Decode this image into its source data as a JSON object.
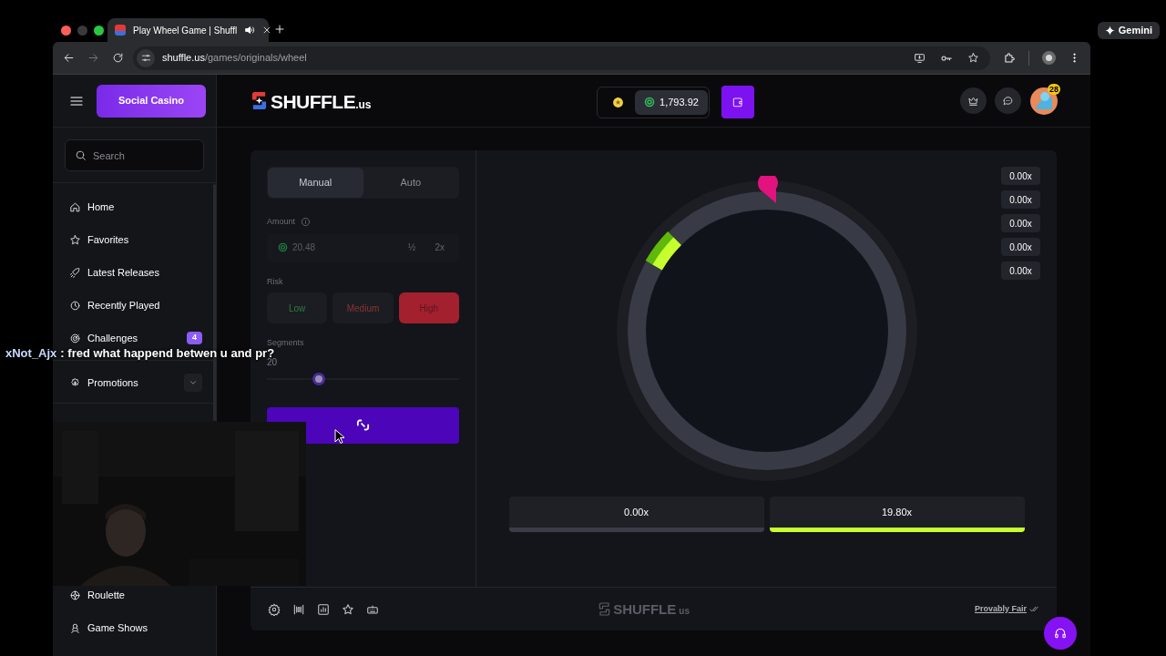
{
  "browser": {
    "tab": {
      "title": "Play Wheel Game | Shuffl"
    },
    "url": {
      "host": "shuffle.us",
      "path": "/games/originals/wheel"
    },
    "gemini": "Gemini"
  },
  "sidebar": {
    "promo_button": "Social Casino",
    "search": {
      "placeholder": "Search"
    },
    "items": [
      {
        "label": "Home",
        "kind": "link"
      },
      {
        "label": "Favorites",
        "kind": "link"
      },
      {
        "label": "Latest Releases",
        "kind": "link"
      },
      {
        "label": "Recently Played",
        "kind": "link"
      },
      {
        "label": "Challenges",
        "kind": "link",
        "badge": "4"
      },
      {
        "label": "Promotions",
        "kind": "group"
      }
    ],
    "items_below": [
      {
        "label": "Roulette"
      },
      {
        "label": "Game Shows"
      }
    ]
  },
  "header": {
    "logo": {
      "name": "SHUFFLE",
      "suffix": ".us"
    },
    "balance": "1,793.92",
    "notifications": "28"
  },
  "game": {
    "modes": [
      {
        "label": "Manual",
        "selected": true
      },
      {
        "label": "Auto",
        "selected": false
      }
    ],
    "amount": {
      "label": "Amount",
      "value": "20.48",
      "half": "½",
      "double": "2x"
    },
    "risk": {
      "label": "Risk",
      "options": [
        {
          "label": "Low",
          "color": "#2f7a45",
          "selected": false
        },
        {
          "label": "Medium",
          "color": "#8a3434",
          "selected": false
        },
        {
          "label": "High",
          "color": "#a3202f",
          "selected": true
        }
      ]
    },
    "segments": {
      "label": "Segments",
      "value": "20",
      "level": 0.27
    },
    "history": [
      "0.00x",
      "0.00x",
      "0.00x",
      "0.00x",
      "0.00x"
    ],
    "outcomes": [
      {
        "label": "0.00x",
        "color": "#3a3d48"
      },
      {
        "label": "19.80x",
        "color": "#c6ff2e"
      }
    ],
    "footer": {
      "logo": {
        "name": "SHUFFLE",
        "suffix": "us"
      },
      "fair_link": "Provably Fair"
    }
  },
  "stream_overlay": {
    "chat": {
      "user": "xNot_Ajx",
      "message": ": fred what happend betwen u and pr?"
    }
  }
}
